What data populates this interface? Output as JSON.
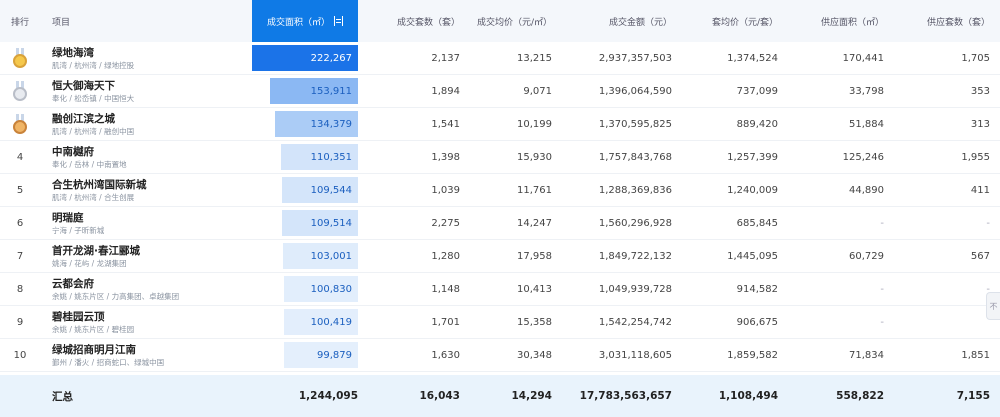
{
  "headers": {
    "rank": "排行",
    "project": "项目",
    "area": "成交面积（㎡）",
    "sets": "成交套数",
    "sets_unit": "（套）",
    "price": "成交均价",
    "price_unit": "（元/㎡）",
    "amount": "成交金额",
    "amount_unit": "（元）",
    "unit_price": "套均价",
    "unit_price_unit": "（元/套）",
    "supply_area": "供应面积",
    "supply_area_unit": "（㎡）",
    "supply_sets": "供应套数",
    "supply_sets_unit": "（套）"
  },
  "rows": [
    {
      "rank": "1",
      "medal": "gold",
      "name": "绿地海湾",
      "sub": "肌湾 / 杭州湾 / 绿地控股",
      "area": "222,267",
      "area_value": 222267,
      "sets": "2,137",
      "price": "13,215",
      "amount": "2,937,357,503",
      "unit_price": "1,374,524",
      "supply_area": "170,441",
      "supply_sets": "1,705"
    },
    {
      "rank": "2",
      "medal": "silver",
      "name": "恒大御海天下",
      "sub": "奉化 / 松岙镇 / 中国恒大",
      "area": "153,911",
      "area_value": 153911,
      "sets": "1,894",
      "price": "9,071",
      "amount": "1,396,064,590",
      "unit_price": "737,099",
      "supply_area": "33,798",
      "supply_sets": "353"
    },
    {
      "rank": "3",
      "medal": "bronze",
      "name": "融创江滨之城",
      "sub": "肌湾 / 杭州湾 / 融创中国",
      "area": "134,379",
      "area_value": 134379,
      "sets": "1,541",
      "price": "10,199",
      "amount": "1,370,595,825",
      "unit_price": "889,420",
      "supply_area": "51,884",
      "supply_sets": "313"
    },
    {
      "rank": "4",
      "medal": "",
      "name": "中南樾府",
      "sub": "奉化 / 岳林 / 中南置地",
      "area": "110,351",
      "area_value": 110351,
      "sets": "1,398",
      "price": "15,930",
      "amount": "1,757,843,768",
      "unit_price": "1,257,399",
      "supply_area": "125,246",
      "supply_sets": "1,955"
    },
    {
      "rank": "5",
      "medal": "",
      "name": "合生杭州湾国际新城",
      "sub": "肌湾 / 杭州湾 / 合生创展",
      "area": "109,544",
      "area_value": 109544,
      "sets": "1,039",
      "price": "11,761",
      "amount": "1,288,369,836",
      "unit_price": "1,240,009",
      "supply_area": "44,890",
      "supply_sets": "411"
    },
    {
      "rank": "6",
      "medal": "",
      "name": "明瑞庭",
      "sub": "宁海 / 子昕新城",
      "area": "109,514",
      "area_value": 109514,
      "sets": "2,275",
      "price": "14,247",
      "amount": "1,560,296,928",
      "unit_price": "685,845",
      "supply_area": "-",
      "supply_sets": "-"
    },
    {
      "rank": "7",
      "medal": "",
      "name": "首开龙湖·春江郦城",
      "sub": "姚海 / 花屿 / 龙湖集团",
      "area": "103,001",
      "area_value": 103001,
      "sets": "1,280",
      "price": "17,958",
      "amount": "1,849,722,132",
      "unit_price": "1,445,095",
      "supply_area": "60,729",
      "supply_sets": "567"
    },
    {
      "rank": "8",
      "medal": "",
      "name": "云都会府",
      "sub": "余姚 / 姚东片区 / 力高集团、卓越集团",
      "area": "100,830",
      "area_value": 100830,
      "sets": "1,148",
      "price": "10,413",
      "amount": "1,049,939,728",
      "unit_price": "914,582",
      "supply_area": "-",
      "supply_sets": "-"
    },
    {
      "rank": "9",
      "medal": "",
      "name": "碧桂园云顶",
      "sub": "余姚 / 姚东片区 / 碧桂园",
      "area": "100,419",
      "area_value": 100419,
      "sets": "1,701",
      "price": "15,358",
      "amount": "1,542,254,742",
      "unit_price": "906,675",
      "supply_area": "-",
      "supply_sets": ""
    },
    {
      "rank": "10",
      "medal": "",
      "name": "绿城招商明月江南",
      "sub": "鄞州 / 潘火 / 招商蛇口、绿城中国",
      "area": "99,879",
      "area_value": 99879,
      "sets": "1,630",
      "price": "30,348",
      "amount": "3,031,118,605",
      "unit_price": "1,859,582",
      "supply_area": "71,834",
      "supply_sets": "1,851"
    }
  ],
  "summary": {
    "label": "汇总",
    "area": "1,244,095",
    "sets": "16,043",
    "price": "14,294",
    "amount": "17,783,563,657",
    "unit_price": "1,108,494",
    "supply_area": "558,822",
    "supply_sets": "7,155"
  },
  "side_button": "不",
  "colors": {
    "bar_dark": "#1b73e8",
    "bar_light": "#e6f0fc",
    "header_accent": "#0f7ae6"
  }
}
